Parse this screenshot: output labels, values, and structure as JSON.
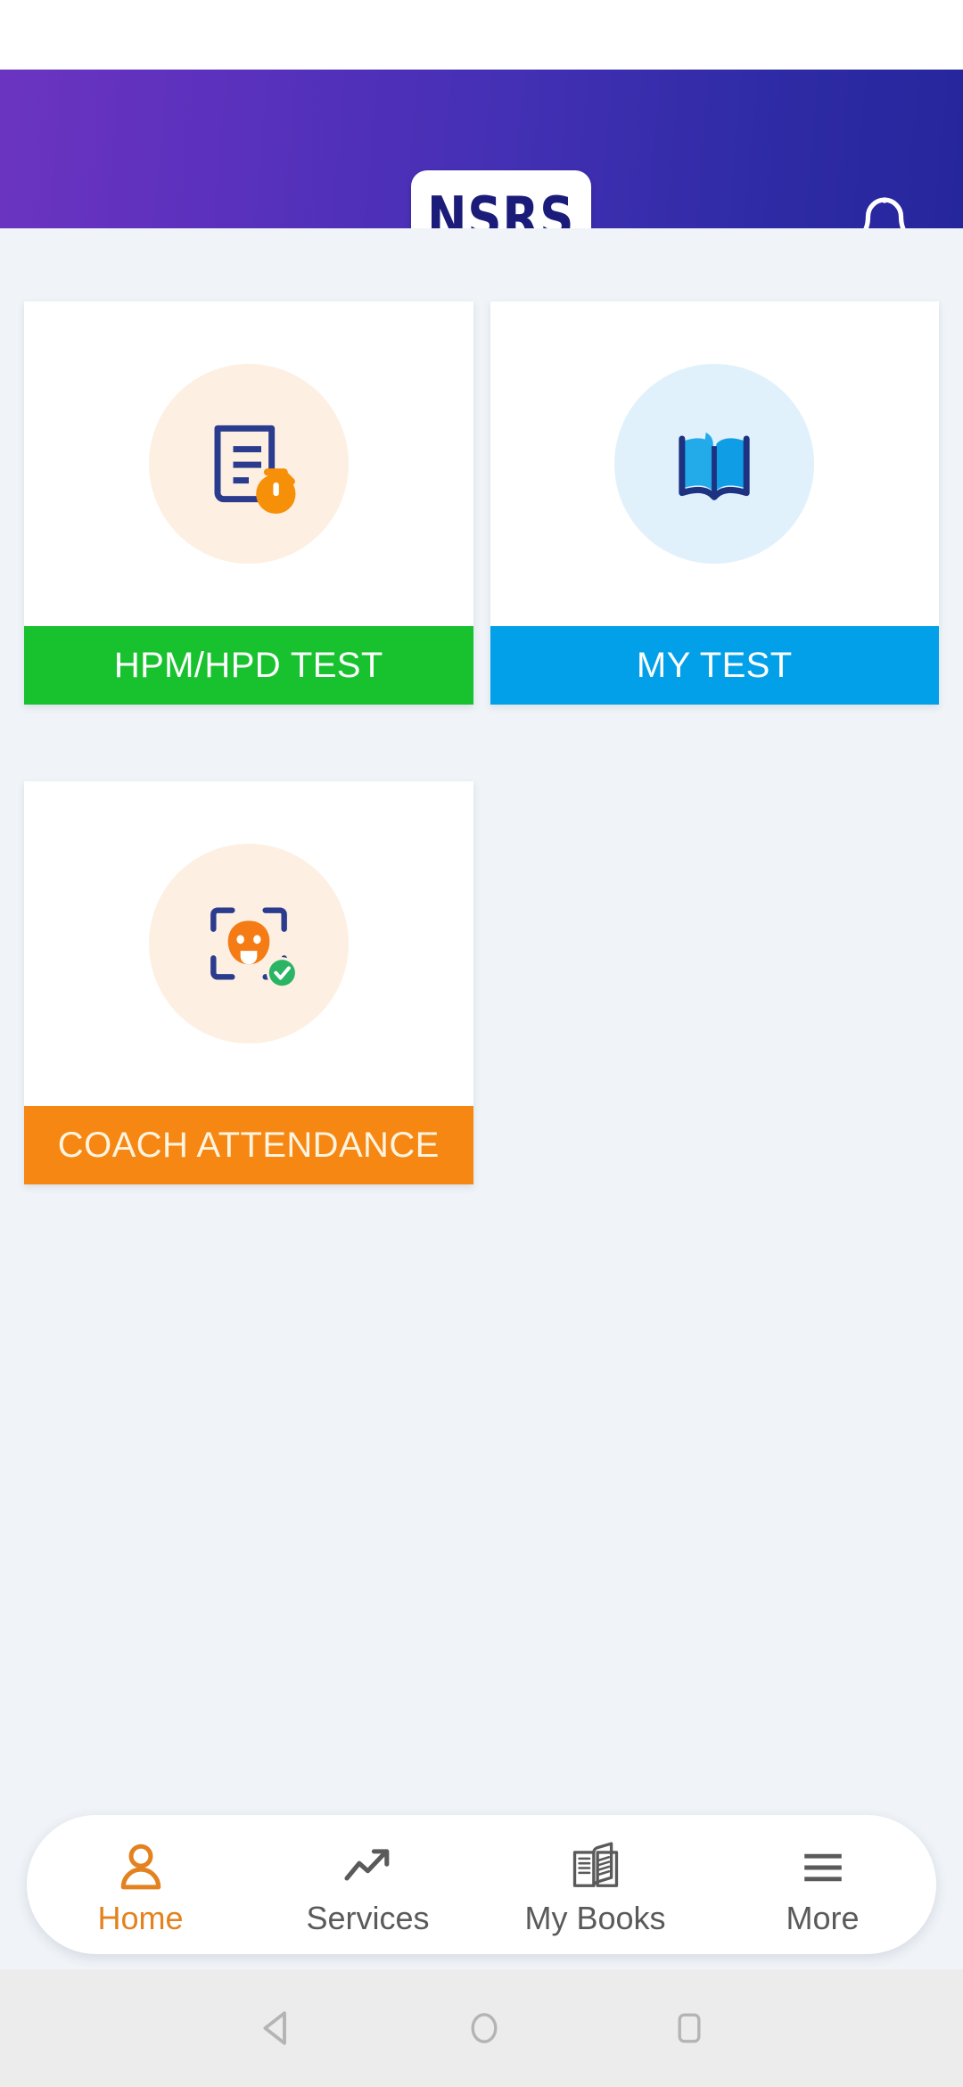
{
  "app": {
    "logo_text": "NSRS",
    "background_color": "#f0f4f8",
    "header_gradient_from": "#6b34c0",
    "header_gradient_to": "#26269c"
  },
  "header": {
    "notification_icon": "bell-icon",
    "notification_label": "Notifications"
  },
  "main": {
    "tiles": [
      {
        "label": "HPM/HPD TEST",
        "icon": "document-stopwatch-icon",
        "bar_color": "#18c22e",
        "circle_color": "#fdf0e2",
        "text_color": "#ffffff"
      },
      {
        "label": "MY TEST",
        "icon": "open-book-icon",
        "bar_color": "#02a0e8",
        "circle_color": "#e0f1fb",
        "text_color": "#ffffff"
      },
      {
        "label": "COACH ATTENDANCE",
        "icon": "face-scan-check-icon",
        "bar_color": "#f68712",
        "circle_color": "#fdf0e2",
        "text_color": "#fff4e0"
      }
    ]
  },
  "bottom_nav": {
    "active_color": "#e3821f",
    "inactive_color": "#5a5a5a",
    "items": [
      {
        "label": "Home",
        "icon": "person-icon",
        "active": true
      },
      {
        "label": "Services",
        "icon": "trending-up-icon",
        "active": false
      },
      {
        "label": "My Books",
        "icon": "open-book-icon",
        "active": false
      },
      {
        "label": "More",
        "icon": "hamburger-icon",
        "active": false
      }
    ]
  },
  "system_nav": {
    "back": "back-triangle-icon",
    "home": "home-circle-icon",
    "recents": "recents-square-icon"
  }
}
